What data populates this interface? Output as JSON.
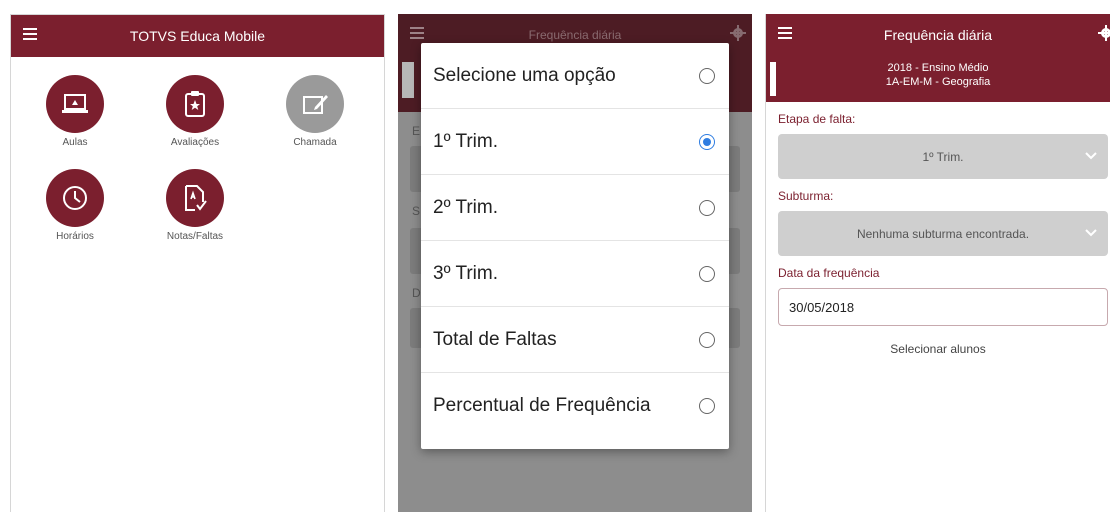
{
  "screen1": {
    "header_title": "TOTVS Educa Mobile",
    "tiles": [
      {
        "label": "Aulas",
        "icon": "laptop-icon"
      },
      {
        "label": "Avaliações",
        "icon": "clipboard-star-icon"
      },
      {
        "label": "Chamada",
        "icon": "edit-icon"
      },
      {
        "label": "Horários",
        "icon": "clock-icon"
      },
      {
        "label": "Notas/Faltas",
        "icon": "document-grade-icon"
      }
    ]
  },
  "screen2": {
    "header_title": "Frequência diária",
    "background_letters": [
      "E",
      "S",
      "D"
    ],
    "dialog": {
      "title": "Selecione uma opção",
      "options": [
        {
          "label": "1º Trim.",
          "selected": true
        },
        {
          "label": "2º Trim.",
          "selected": false
        },
        {
          "label": "3º Trim.",
          "selected": false
        },
        {
          "label": "Total de Faltas",
          "selected": false
        },
        {
          "label": "Percentual de Frequência",
          "selected": false
        }
      ]
    }
  },
  "screen3": {
    "header_title": "Frequência diária",
    "subheader_line1": "2018 - Ensino Médio",
    "subheader_line2": "1A-EM-M - Geografia",
    "etapa_label": "Etapa de falta:",
    "etapa_value": "1º Trim.",
    "subturma_label": "Subturma:",
    "subturma_value": "Nenhuma subturma encontrada.",
    "data_label": "Data da frequência",
    "data_value": "30/05/2018",
    "select_students": "Selecionar alunos"
  },
  "colors": {
    "brand": "#7b1f2e",
    "radio_selected": "#2f7de1",
    "overlay": "#8d8d8d"
  }
}
